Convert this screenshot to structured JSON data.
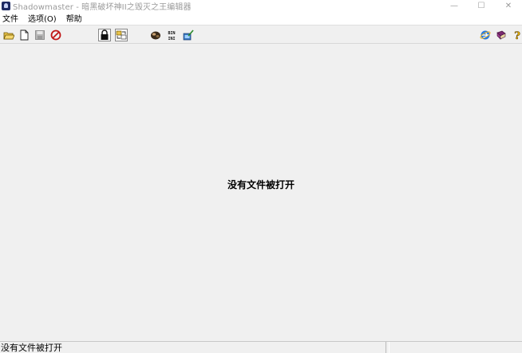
{
  "window": {
    "title": "Shadowmaster - 暗黑破坏神II之毁灭之王编辑器",
    "controls": {
      "minimize": "—",
      "maximize": "☐",
      "close": "✕"
    }
  },
  "menu": {
    "items": [
      {
        "label": "文件"
      },
      {
        "label": "选项(O)"
      },
      {
        "label": "帮助"
      }
    ]
  },
  "toolbar": {
    "buttons": [
      {
        "name": "open-icon"
      },
      {
        "name": "new-file-icon"
      },
      {
        "name": "save-icon"
      },
      {
        "name": "stop-icon"
      },
      {
        "name": "lock-icon",
        "pressed": true
      },
      {
        "name": "transfer-icon",
        "pressed": true
      },
      {
        "name": "character-icon"
      },
      {
        "name": "bin-ini-icon"
      },
      {
        "name": "edit-tool-icon"
      },
      {
        "name": "ie-icon"
      },
      {
        "name": "book-icon"
      },
      {
        "name": "help-icon"
      }
    ]
  },
  "main": {
    "message": "没有文件被打开"
  },
  "statusbar": {
    "main_text": "没有文件被打开",
    "right_text": ""
  },
  "colors": {
    "background": "#f0f0f0",
    "titlebar": "#ffffff",
    "title_text": "#9a9a9a"
  }
}
